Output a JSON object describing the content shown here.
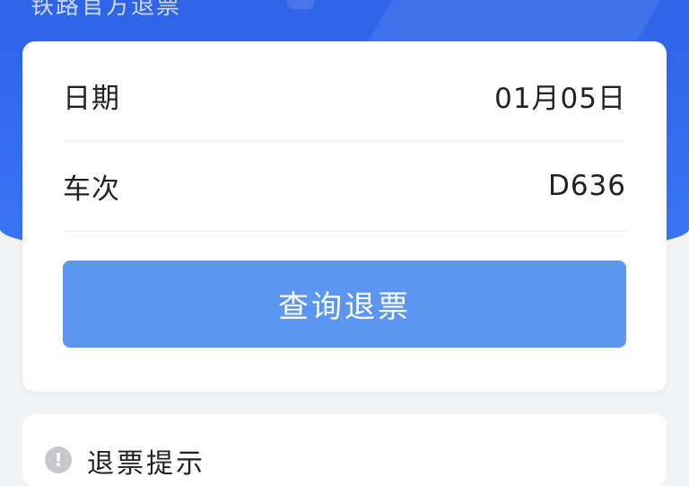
{
  "header": {
    "title": "铁路官方退票"
  },
  "form": {
    "date_label": "日期",
    "date_value": "01月05日",
    "train_label": "车次",
    "train_value": "D636",
    "query_button_label": "查询退票"
  },
  "tips": {
    "icon": "info-icon",
    "icon_glyph": "!",
    "title": "退票提示"
  },
  "colors": {
    "header_blue": "#356ff0",
    "button_blue": "#5b96f2",
    "background": "#f3f4f6"
  }
}
